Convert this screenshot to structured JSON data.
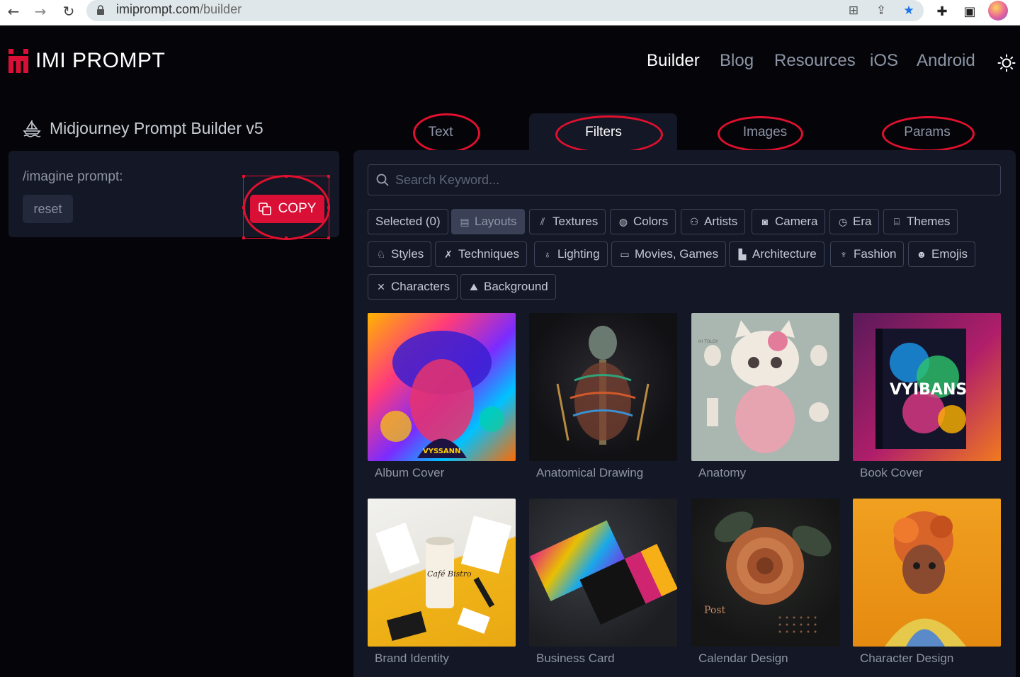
{
  "browser": {
    "url_domain": "imiprompt.com",
    "url_path": "/builder"
  },
  "site": {
    "name": "IMI PROMPT",
    "brand_color": "#d90f36",
    "nav": [
      {
        "label": "Builder",
        "active": true
      },
      {
        "label": "Blog",
        "active": false
      },
      {
        "label": "Resources",
        "active": false
      },
      {
        "label": "iOS",
        "active": false
      },
      {
        "label": "Android",
        "active": false
      }
    ]
  },
  "builder": {
    "title": "Midjourney Prompt Builder v5",
    "prompt_label": "/imagine prompt:",
    "reset_label": "reset",
    "copy_label": "COPY"
  },
  "tabs": [
    {
      "label": "Text",
      "active": false
    },
    {
      "label": "Filters",
      "active": true
    },
    {
      "label": "Images",
      "active": false
    },
    {
      "label": "Params",
      "active": false
    }
  ],
  "search": {
    "placeholder": "Search Keyword..."
  },
  "filters": [
    {
      "label": "Selected (0)",
      "icon": "none"
    },
    {
      "label": "Layouts",
      "icon": "layout-icon",
      "selected": true
    },
    {
      "label": "Textures",
      "icon": "texture-icon"
    },
    {
      "label": "Colors",
      "icon": "palette-icon"
    },
    {
      "label": "Artists",
      "icon": "people-icon"
    },
    {
      "label": "Camera",
      "icon": "camera-icon"
    },
    {
      "label": "Era",
      "icon": "clock-icon"
    },
    {
      "label": "Themes",
      "icon": "themes-icon"
    },
    {
      "label": "Styles",
      "icon": "styles-icon"
    },
    {
      "label": "Techniques",
      "icon": "tools-icon"
    },
    {
      "label": "Lighting",
      "icon": "bulb-icon"
    },
    {
      "label": "Movies, Games",
      "icon": "film-icon"
    },
    {
      "label": "Architecture",
      "icon": "building-icon"
    },
    {
      "label": "Fashion",
      "icon": "shirt-icon"
    },
    {
      "label": "Emojis",
      "icon": "smiley-icon"
    },
    {
      "label": "Characters",
      "icon": "character-icon"
    },
    {
      "label": "Background",
      "icon": "landscape-icon"
    }
  ],
  "cards": [
    {
      "caption": "Album Cover"
    },
    {
      "caption": "Anatomical Drawing"
    },
    {
      "caption": "Anatomy"
    },
    {
      "caption": "Book Cover"
    },
    {
      "caption": "Brand Identity"
    },
    {
      "caption": "Business Card"
    },
    {
      "caption": "Calendar Design"
    },
    {
      "caption": "Character Design"
    }
  ],
  "image_text": {
    "album_cover": "VYSSANN",
    "anatomy": "HI TOLOY",
    "book_cover": "VYIBANS",
    "brand_identity": "Café Bistro",
    "calendar": "Post"
  }
}
